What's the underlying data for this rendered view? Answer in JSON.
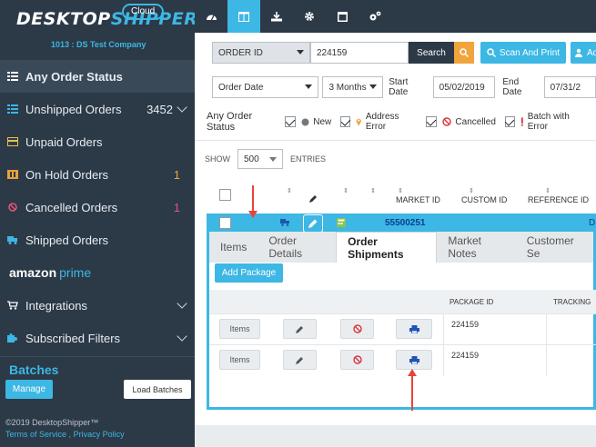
{
  "sidebar": {
    "brand_part1": "DESKTOP",
    "brand_part2": "SHIPPER",
    "cloud": "Cloud",
    "company": "1013 : DS Test Company",
    "items": [
      {
        "label": "Any Order Status",
        "count": "",
        "chevron": false
      },
      {
        "label": "Unshipped Orders",
        "count": "3452",
        "chevron": true
      },
      {
        "label": "Unpaid Orders",
        "count": "",
        "chevron": false
      },
      {
        "label": "On Hold Orders",
        "count": "1",
        "chevron": false
      },
      {
        "label": "Cancelled Orders",
        "count": "1",
        "chevron": false
      },
      {
        "label": "Shipped Orders",
        "count": "",
        "chevron": false
      }
    ],
    "amazon_word": "amazon",
    "prime_word": "prime",
    "integrations": "Integrations",
    "subscribed_filters": "Subscribed Filters",
    "batches_title": "Batches",
    "manage_label": "Manage",
    "load_batches_label": "Load Batches",
    "copyright": "©2019 DesktopShipper™",
    "terms": "Terms of Service",
    "sep": ",",
    "privacy": "Privacy Policy"
  },
  "search": {
    "field_select": "ORDER ID",
    "value": "224159",
    "search_label": "Search",
    "scan_print_label": "Scan And Print",
    "add_label": "Ad"
  },
  "dates": {
    "date_type": "Order Date",
    "range": "3 Months",
    "start_label": "Start Date",
    "start_value": "05/02/2019",
    "end_label": "End Date",
    "end_value": "07/31/2"
  },
  "status_filter": {
    "title": "Any Order Status",
    "options": [
      "New",
      "Address Error",
      "Cancelled",
      "Batch with Error"
    ]
  },
  "entries": {
    "show": "SHOW",
    "value": "500",
    "entries": "ENTRIES"
  },
  "table": {
    "headers": [
      "MARKET ID",
      "CUSTOM ID",
      "REFERENCE ID"
    ],
    "order": {
      "market_id": "55500251",
      "trailing": "D"
    }
  },
  "details": {
    "tabs": [
      "Items",
      "Order Details",
      "Order Shipments",
      "Market Notes",
      "Customer Se"
    ],
    "add_package": "Add Package",
    "ship_headers": [
      "PACKAGE ID",
      "TRACKING"
    ],
    "rows": [
      {
        "items_label": "Items",
        "package_id": "224159"
      },
      {
        "items_label": "Items",
        "package_id": "224159"
      }
    ]
  },
  "colors": {
    "accent": "#3db7e4",
    "sidebar": "#2c3947",
    "orange": "#f0a43b",
    "arrow": "#e8443b"
  }
}
